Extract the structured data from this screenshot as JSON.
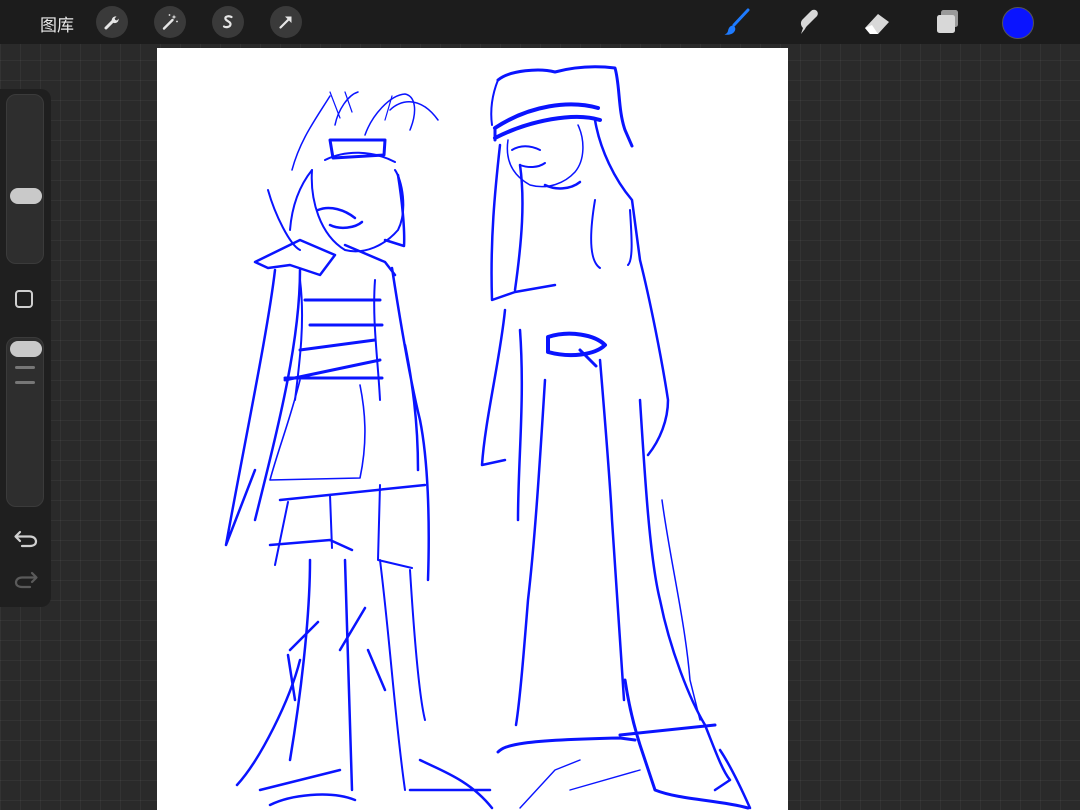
{
  "topbar": {
    "gallery_label": "图库",
    "tools_left": [
      {
        "icon": "wrench-icon"
      },
      {
        "icon": "magic-wand-icon"
      },
      {
        "icon": "selection-s-icon"
      },
      {
        "icon": "transform-arrow-icon"
      }
    ],
    "tools_right": [
      {
        "icon": "brush-icon",
        "active": true
      },
      {
        "icon": "smudge-icon",
        "active": false
      },
      {
        "icon": "eraser-icon",
        "active": false
      },
      {
        "icon": "layers-icon",
        "active": false
      }
    ],
    "current_color": "#0a14ff"
  },
  "colors": {
    "accent_active": "#1e7bff",
    "ink": "#0a14ff",
    "chrome": "#1c1c1c",
    "canvas": "#ffffff"
  },
  "sidebar": {
    "brush_size_level": 0.39,
    "opacity_level": 1.0
  }
}
